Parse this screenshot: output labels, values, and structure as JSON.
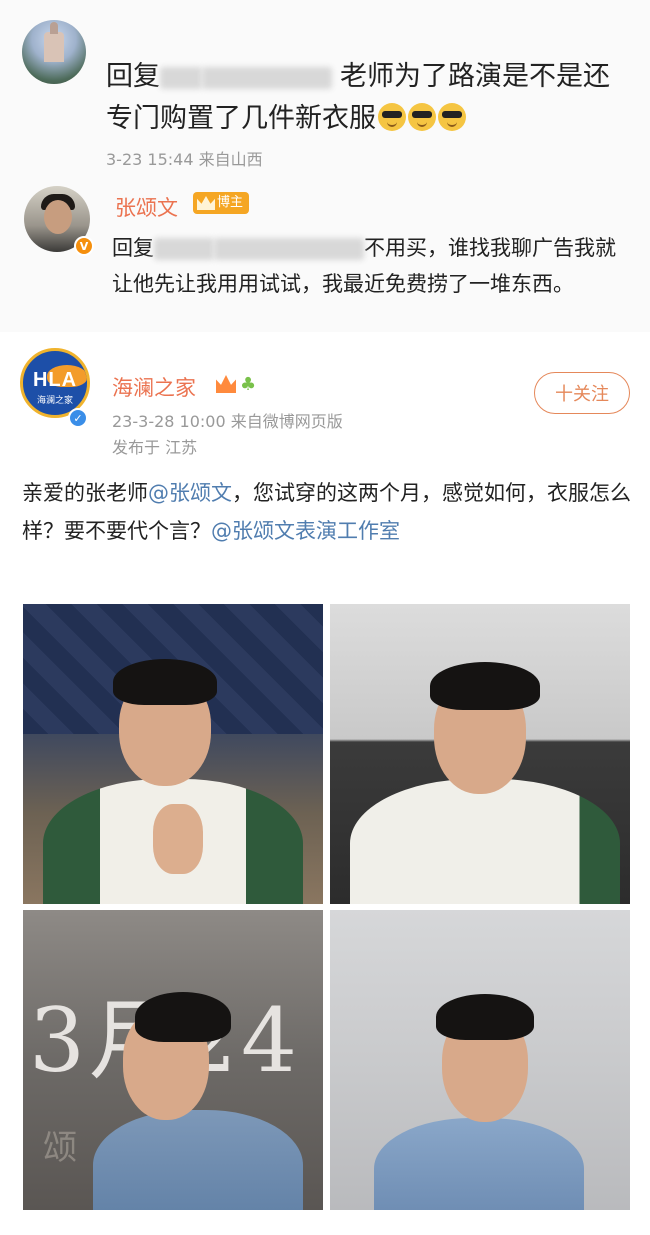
{
  "comment1": {
    "text_prefix": "回复",
    "text_main": "老师为了路演是不是还专门购置了几件新衣服",
    "time": "3-23 15:44 来自山西"
  },
  "comment2": {
    "author": "张颂文",
    "author_badge": "博主",
    "text_prefix": "回复",
    "text_main": "不用买，谁找我聊广告我就让他先让我用用试试，我最近免费捞了一堆东西。"
  },
  "post": {
    "avatar_text": "HLA",
    "avatar_sub": "海澜之家",
    "author": "海澜之家",
    "follow_label": "十关注",
    "meta": "23-3-28 10:00  来自微博网页版",
    "location": "发布于 江苏",
    "body_part1": "亲爱的张老师",
    "mention1": "@张颂文",
    "body_part2": "，您试穿的这两个月，感觉如何，衣服怎么样？要不要代个言？",
    "mention2": "@张颂文表演工作室",
    "photo3_text": "3月24",
    "photo3_sub": "颂 文"
  },
  "colors": {
    "name_orange": "#eb7350",
    "mention_blue": "#507daf",
    "meta_gray": "#999999"
  }
}
